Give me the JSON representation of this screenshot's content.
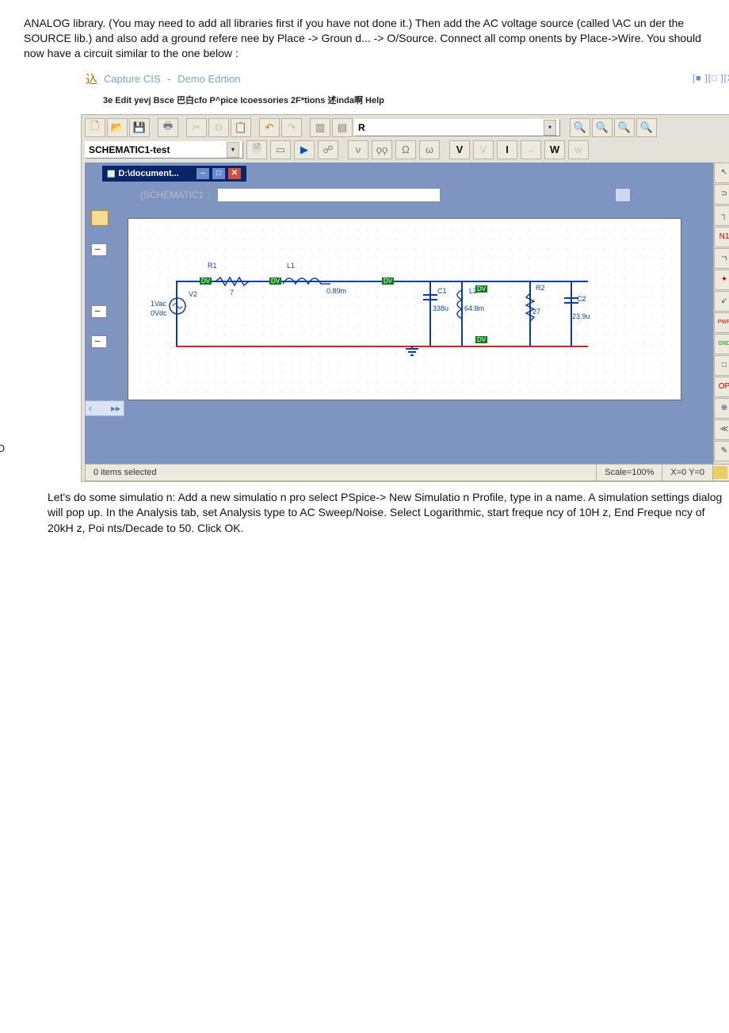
{
  "intro_text": "ANALOG library. (You may need to add all libraries first if you have not done it.) Then add the AC voltage source (called \\AC un der the SOURCE lib.) and also add a ground refere nee by Place -> Groun d... -> O/Source. Connect all comp onents by Place->Wire. You should now have a circuit similar to the one below :",
  "margin_letter": "O",
  "titlebar": {
    "cjk": "込",
    "app": "Capture CIS",
    "sep": "-",
    "edition": "Demo Edrtion",
    "controls": "[■ ][□ ][X"
  },
  "menu": {
    "raw": "3e Edit yevj Bsce  巴白cfo P^pice Icoessories 2F*tions 述inda啊  Help"
  },
  "toolbar_combo_value": "R",
  "row2": {
    "combo": "SCHEMATIC1-test",
    "btn_V": "V",
    "btn_I": "I",
    "btn_W": "W"
  },
  "doc_window": {
    "title": "D:\\document..."
  },
  "schem_tab_label": "(SCHEMATIC1 :",
  "circuit": {
    "R1": "R1",
    "L1": "L1",
    "L1_val": "0.89m",
    "V2": "V2",
    "V2_a": "1Vac",
    "V2_b": "0Vdc",
    "C1": "C1",
    "C1_val": "338u",
    "L2": "L2",
    "L2_val": "64.8m",
    "R2": "R2",
    "R2_val": "27",
    "C2": "C2",
    "C2_val": "23.9u",
    "R1_val": "7",
    "probe": "DV"
  },
  "statusbar": {
    "sel": "0 items selected",
    "scale": "Scale=100%",
    "coords": "X=0  Y=0"
  },
  "palette": {
    "p1": "↖",
    "p2": "⊃",
    "p3": "┐",
    "p4": "N1",
    "p5": "ㄱ",
    "p6": "✦",
    "p7": "↙",
    "p8": "PWR",
    "p9": "GND",
    "p10": "□",
    "p11": "OP",
    "p12": "⊕",
    "p13": "≪",
    "p14": "✎"
  },
  "below_text": "Let's do some simulatio n: Add a new simulatio n pro select PSpice-> New Simulatio n Profile, type in a name. A simulation settings dialog will pop up. In the Analysis tab, set Analysis type to AC Sweep/Noise. Select Logarithmic, start freque ncy of 10H z, End Freque ncy of 20kH z, Poi nts/Decade to 50. Click OK."
}
